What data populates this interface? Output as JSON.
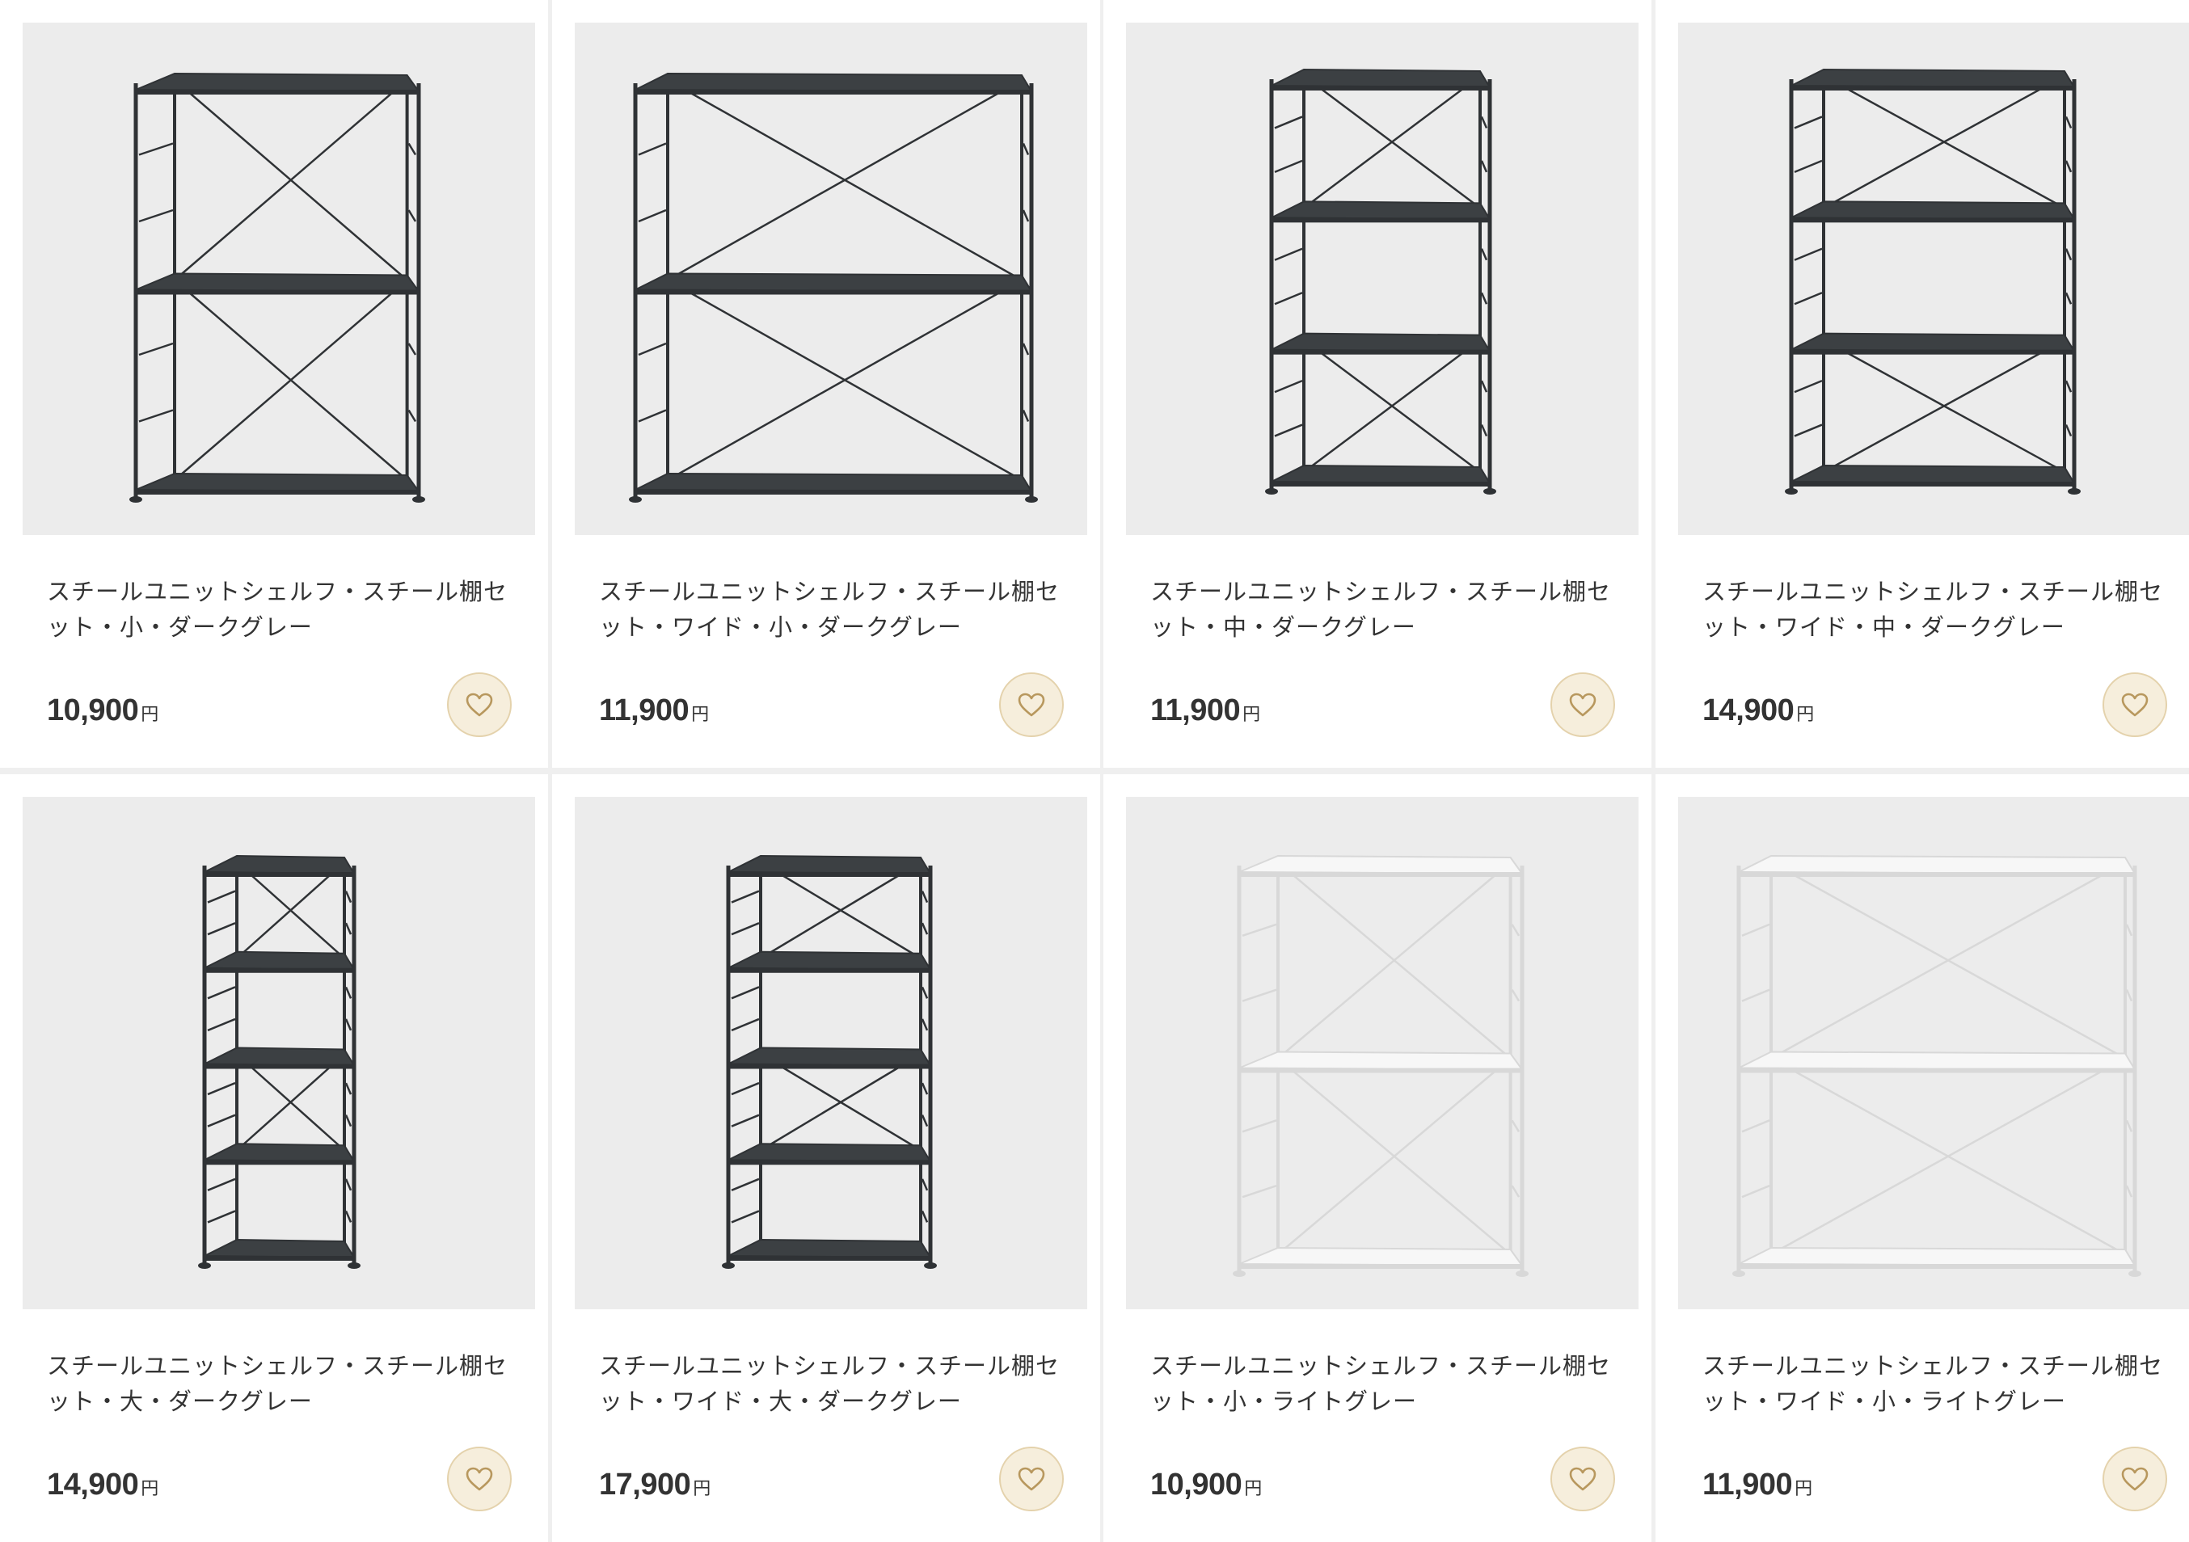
{
  "products": [
    {
      "name": "スチールユニットシェルフ・スチール棚セット・小・ダークグレー",
      "price": "10,900",
      "currency": "円",
      "frame_color": "#2f3235",
      "shelf_color": "#3c4043",
      "icon": "heart-icon"
    },
    {
      "name": "スチールユニットシェルフ・スチール棚セット・ワイド・小・ダークグレー",
      "price": "11,900",
      "currency": "円",
      "frame_color": "#2f3235",
      "shelf_color": "#3c4043",
      "icon": "heart-icon"
    },
    {
      "name": "スチールユニットシェルフ・スチール棚セット・中・ダークグレー",
      "price": "11,900",
      "currency": "円",
      "frame_color": "#2f3235",
      "shelf_color": "#3c4043",
      "icon": "heart-icon"
    },
    {
      "name": "スチールユニットシェルフ・スチール棚セット・ワイド・中・ダークグレー",
      "price": "14,900",
      "currency": "円",
      "frame_color": "#2f3235",
      "shelf_color": "#3c4043",
      "icon": "heart-icon"
    },
    {
      "name": "スチールユニットシェルフ・スチール棚セット・大・ダークグレー",
      "price": "14,900",
      "currency": "円",
      "frame_color": "#2f3235",
      "shelf_color": "#3c4043",
      "icon": "heart-icon"
    },
    {
      "name": "スチールユニットシェルフ・スチール棚セット・ワイド・大・ダークグレー",
      "price": "17,900",
      "currency": "円",
      "frame_color": "#2f3235",
      "shelf_color": "#3c4043",
      "icon": "heart-icon"
    },
    {
      "name": "スチールユニットシェルフ・スチール棚セット・小・ライトグレー",
      "price": "10,900",
      "currency": "円",
      "frame_color": "#ffffff",
      "shelf_color": "#f7f7f7",
      "icon": "heart-icon"
    },
    {
      "name": "スチールユニットシェルフ・スチール棚セット・ワイド・小・ライトグレー",
      "price": "11,900",
      "currency": "円",
      "frame_color": "#ffffff",
      "shelf_color": "#f7f7f7",
      "icon": "heart-icon"
    }
  ]
}
